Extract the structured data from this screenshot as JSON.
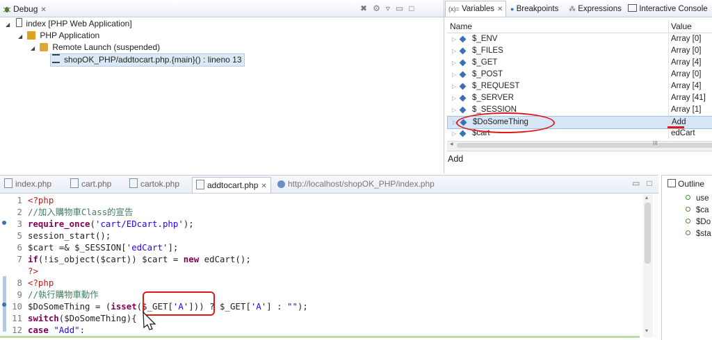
{
  "debug": {
    "tab_label": "Debug",
    "tree": [
      {
        "label": "index [PHP Web Application]"
      },
      {
        "label": "PHP Application"
      },
      {
        "label": "Remote Launch (suspended)"
      },
      {
        "label": "shopOK_PHP/addtocart.php.{main}() : lineno 13"
      }
    ]
  },
  "variables": {
    "tabs": [
      "Variables",
      "Breakpoints",
      "Expressions",
      "Interactive Console"
    ],
    "tab_prefix": "(x)=",
    "col_name": "Name",
    "col_value": "Value",
    "rows": [
      {
        "name": "$_ENV",
        "value": "Array [0]"
      },
      {
        "name": "$_FILES",
        "value": "Array [0]"
      },
      {
        "name": "$_GET",
        "value": "Array [4]"
      },
      {
        "name": "$_POST",
        "value": "Array [0]"
      },
      {
        "name": "$_REQUEST",
        "value": "Array [4]"
      },
      {
        "name": "$_SERVER",
        "value": "Array [41]"
      },
      {
        "name": "$_SESSION",
        "value": "Array [1]"
      },
      {
        "name": "$DoSomeThing",
        "value": "Add"
      },
      {
        "name": "$cart",
        "value": "edCart"
      }
    ],
    "scroll_grip": "III",
    "detail": "Add"
  },
  "editor": {
    "tabs": [
      "index.php",
      "cart.php",
      "cartok.php",
      "addtocart.php",
      "http://localhost/shopOK_PHP/index.php"
    ],
    "lines": [
      {
        "n": "1",
        "html": "<span class='tag'>&lt;?php</span>"
      },
      {
        "n": "2",
        "html": "<span class='cm'>//加入購物車Class的宣告</span>"
      },
      {
        "n": "3",
        "html": "<span class='kw'>require_once</span>(<span class='str'>'cart/EDcart.php'</span>);"
      },
      {
        "n": "5",
        "html": "session_start();"
      },
      {
        "n": "6",
        "html": "$cart =&amp; $_SESSION[<span class='str'>'edCart'</span>];"
      },
      {
        "n": "7",
        "html": "<span class='kw'>if</span>(!is_object($cart)) $cart = <span class='kw'>new</span> edCart();"
      },
      {
        "n": "",
        "html": "<span class='tag'>?&gt;</span>"
      },
      {
        "n": "8",
        "html": "<span class='tag'>&lt;?php</span>"
      },
      {
        "n": "9",
        "html": "<span class='cm'>//執行購物車動作</span>"
      },
      {
        "n": "10",
        "html": "$DoSomeThing = (<span class='kw'>isset</span>($_GET[<span class='str'>'A'</span>])) ? $_GET[<span class='str'>'A'</span>] : <span class='str'>\"\"</span>);"
      },
      {
        "n": "11",
        "html": "<span class='kw'>switch</span>($DoSomeThing){"
      },
      {
        "n": "12",
        "html": "<span class='kw'>case</span> <span class='str'>\"Add\"</span>:"
      }
    ]
  },
  "outline": {
    "title": "Outline",
    "items": [
      "use",
      "$ca",
      "$Do",
      "$sta"
    ]
  }
}
